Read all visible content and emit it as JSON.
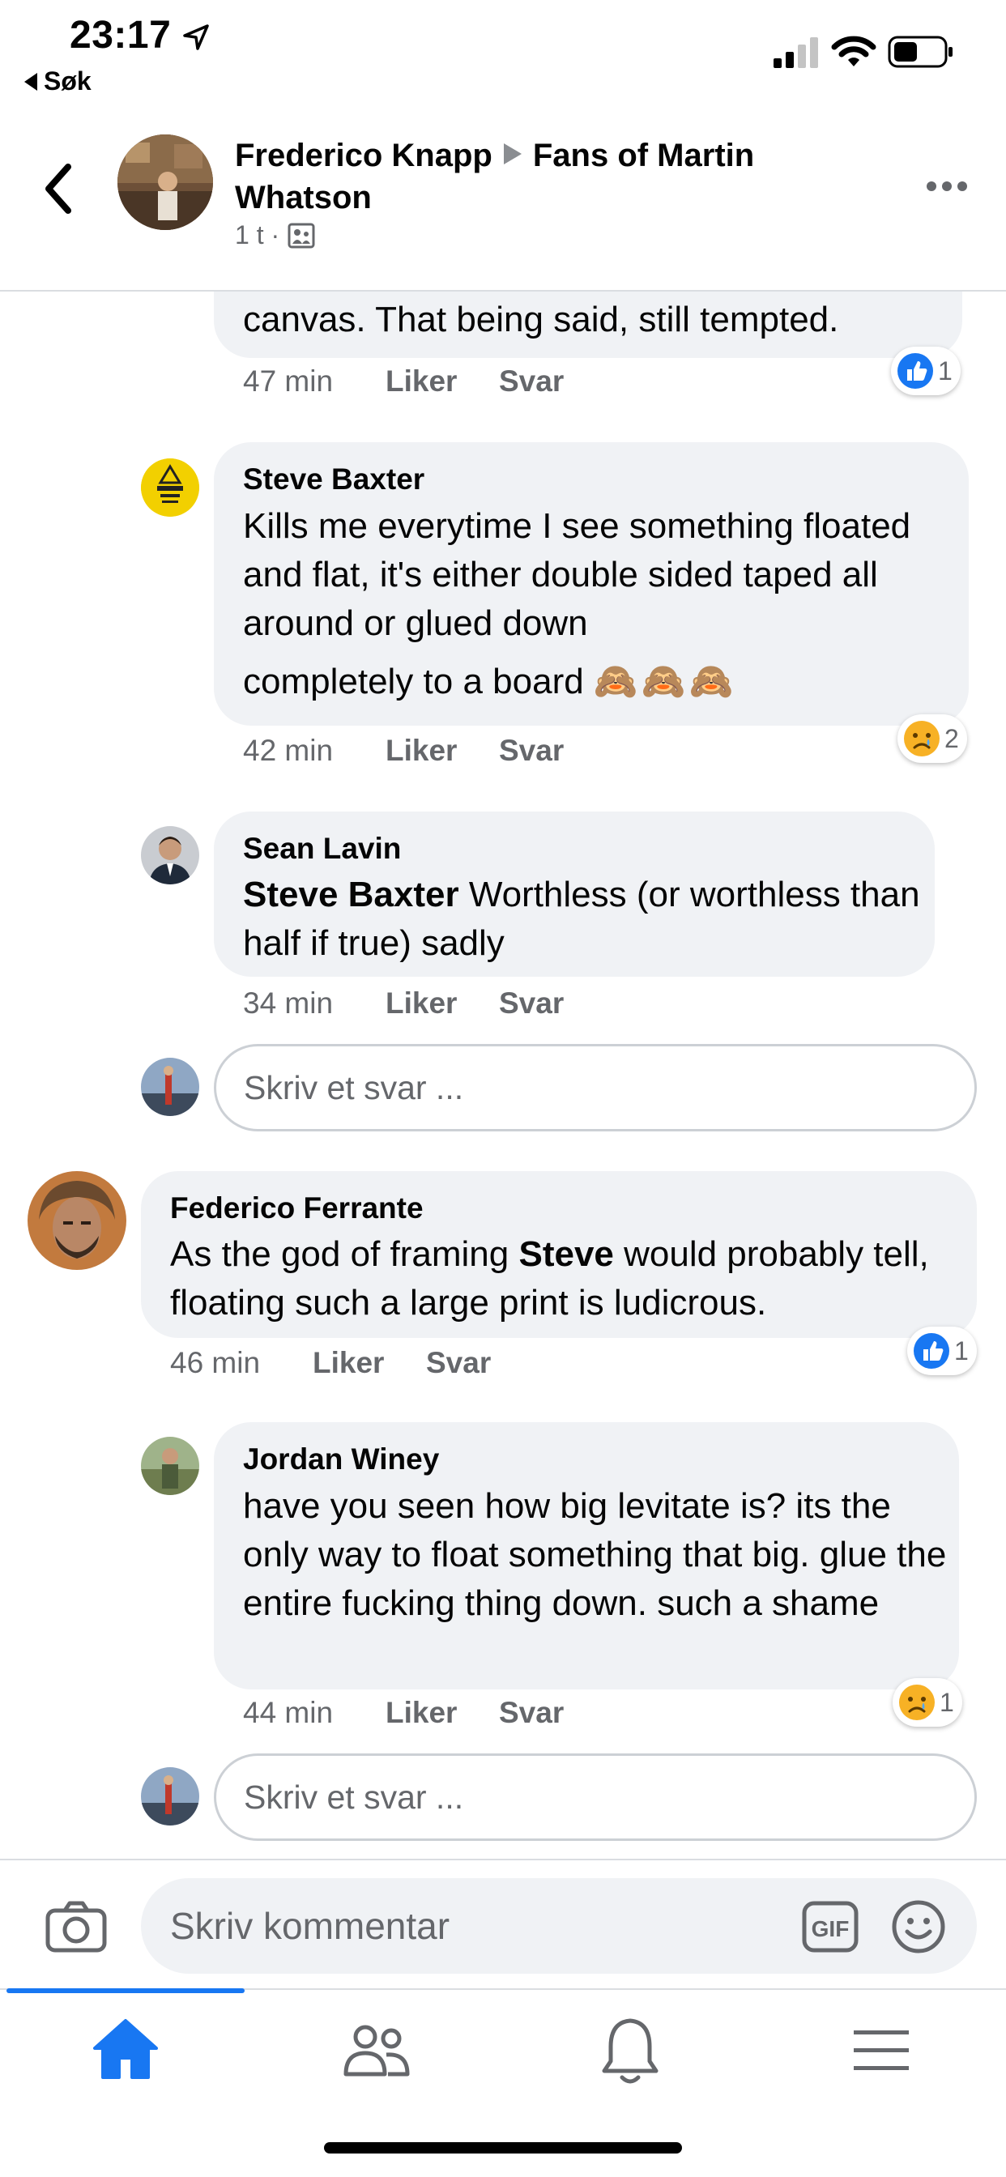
{
  "status_bar": {
    "time": "23:17",
    "back_app": "Søk"
  },
  "header": {
    "author": "Frederico Knapp",
    "group": "Fans of Martin Whatson",
    "meta": "1 t ·"
  },
  "comments": [
    {
      "text_tail": "canvas. That being said, still tempted.",
      "time": "47 min",
      "like": "Liker",
      "reply": "Svar",
      "reaction": {
        "type": "like",
        "count": "1"
      }
    },
    {
      "author": "Steve Baxter",
      "text": "Kills me everytime I see something floated and flat,  it's either double sided taped all around or glued down",
      "text_last": "completely to a board",
      "emoji": "🙈🙈🙈",
      "time": "42 min",
      "like": "Liker",
      "reply": "Svar",
      "reaction": {
        "type": "sad",
        "count": "2"
      }
    },
    {
      "author": "Sean Lavin",
      "mention": "Steve Baxter",
      "text": " Worthless (or worthless than half if true) sadly",
      "time": "34 min",
      "like": "Liker",
      "reply": "Svar"
    },
    {
      "author": "Federico Ferrante",
      "text_a": "As the god of framing ",
      "mention": "Steve",
      "text_b": " would probably tell, floating such a large print is ludicrous.",
      "time": "46 min",
      "like": "Liker",
      "reply": "Svar",
      "reaction": {
        "type": "like",
        "count": "1"
      }
    },
    {
      "author": "Jordan Winey",
      "text": "have you seen how big levitate is? its the only way to float something that big. glue the entire fucking thing down. such a shame",
      "time": "44 min",
      "like": "Liker",
      "reply": "Svar",
      "reaction": {
        "type": "sad",
        "count": "1"
      }
    }
  ],
  "reply_placeholder": "Skriv et svar ...",
  "composer": {
    "placeholder": "Skriv kommentar",
    "gif_label": "GIF"
  },
  "colors": {
    "accent": "#1877f2",
    "bubble": "#f0f2f5",
    "muted": "#65676b"
  },
  "icons": [
    "location-arrow-icon",
    "signal-icon",
    "wifi-icon",
    "battery-icon",
    "back-chevron-icon",
    "more-icon",
    "camera-icon",
    "gif-icon",
    "emoji-icon",
    "home-icon",
    "friends-icon",
    "bell-icon",
    "menu-icon"
  ]
}
